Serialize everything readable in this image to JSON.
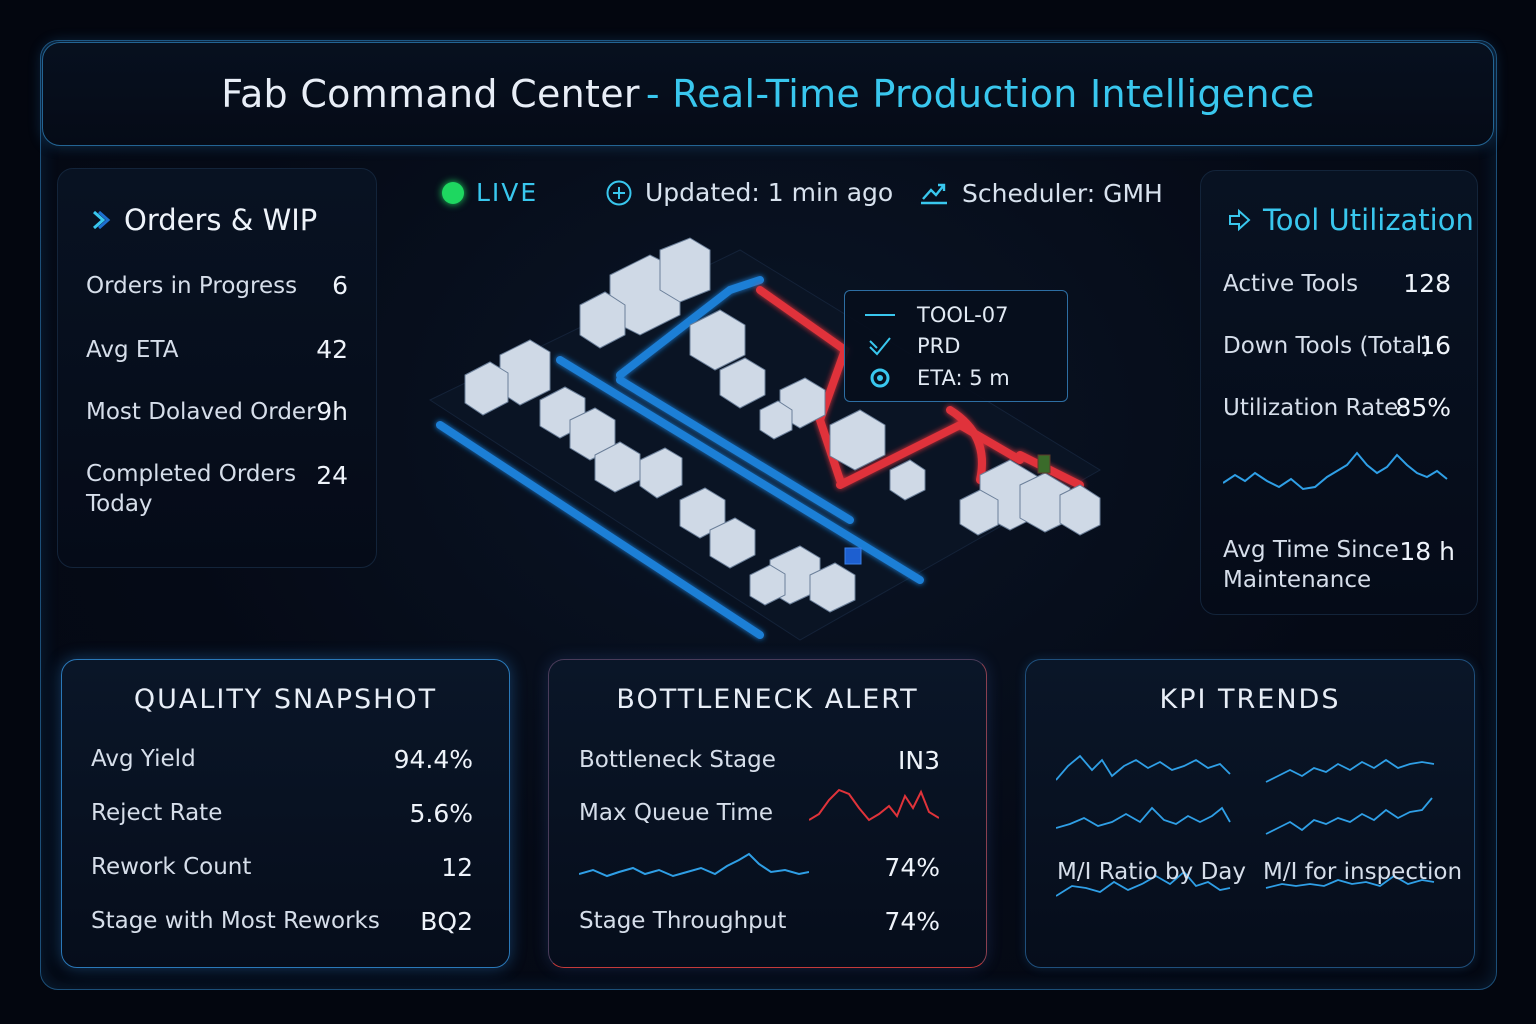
{
  "header": {
    "title_main": "Fab Command Center",
    "title_accent": "- Real-Time Production Intelligence"
  },
  "status": {
    "live": "LIVE",
    "updated": "Updated: 1 min ago",
    "scheduler": "Scheduler: GMH"
  },
  "tooltip": {
    "tool": "TOOL-07",
    "state": "PRD",
    "eta": "ETA: 5 m"
  },
  "orders": {
    "title": "Orders & WIP",
    "rows": [
      {
        "label": "Orders in Progress",
        "value": "6"
      },
      {
        "label": "Avg ETA",
        "value": "42"
      },
      {
        "label": "Most Dolaved Order",
        "value": "9h"
      },
      {
        "label": "Completed Orders",
        "label2": "Today",
        "value": "24"
      }
    ]
  },
  "tools": {
    "title": "Tool Utilization",
    "rows": [
      {
        "label": "Active Tools",
        "value": "128"
      },
      {
        "label": "Down Tools (Total)",
        "value": "16"
      },
      {
        "label": "Utilization Rate",
        "value": "85%"
      },
      {
        "label": "Avg Time Since",
        "label2": "Maintenance",
        "value": "18 h"
      }
    ]
  },
  "quality": {
    "title": "QUALITY SNAPSHOT",
    "rows": [
      {
        "label": "Avg Yield",
        "value": "94.4%"
      },
      {
        "label": "Reject Rate",
        "value": "5.6%"
      },
      {
        "label": "Rework Count",
        "value": "12"
      },
      {
        "label": "Stage with Most Reworks",
        "value": "BQ2"
      }
    ]
  },
  "bottleneck": {
    "title": "BOTTLENECK ALERT",
    "stage_label": "Bottleneck Stage",
    "stage_value": "IN3",
    "queue_label": "Max Queue Time",
    "spark_value": "74%",
    "throughput_label": "Stage Throughput",
    "throughput_value": "74%"
  },
  "kpi": {
    "title": "KPI TRENDS",
    "label_left": "M/I Ratio by Day",
    "label_right": "M/I for inspection"
  },
  "colors": {
    "accent": "#39c7ee",
    "live": "#1ed760",
    "alert": "#e0333a",
    "road": "#1f7fd6"
  },
  "icons": [
    "chevron-right-icon",
    "plus-circle-icon",
    "trend-icon",
    "arrow-right-icon",
    "check-icon",
    "target-icon"
  ]
}
